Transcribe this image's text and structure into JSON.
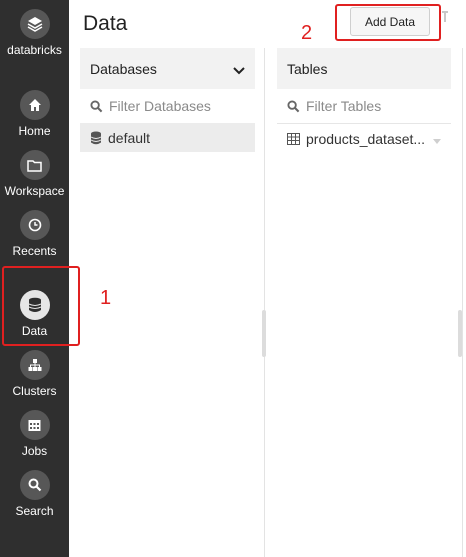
{
  "sidebar": {
    "brand_label": "databricks",
    "items": [
      {
        "label": "Home",
        "icon": "home-icon"
      },
      {
        "label": "Workspace",
        "icon": "folder-icon"
      },
      {
        "label": "Recents",
        "icon": "clock-icon"
      },
      {
        "label": "Data",
        "icon": "database-icon",
        "active": true
      },
      {
        "label": "Clusters",
        "icon": "clusters-icon"
      },
      {
        "label": "Jobs",
        "icon": "calendar-icon"
      },
      {
        "label": "Search",
        "icon": "search-icon"
      }
    ]
  },
  "header": {
    "title": "Data",
    "add_data_label": "Add Data"
  },
  "databases_panel": {
    "title": "Databases",
    "filter_placeholder": "Filter Databases",
    "items": [
      "default"
    ]
  },
  "tables_panel": {
    "title": "Tables",
    "filter_placeholder": "Filter Tables",
    "items": [
      "products_dataset..."
    ]
  },
  "annotations": {
    "first": "1",
    "second": "2"
  },
  "colors": {
    "sidebar_bg": "#2f2f2f",
    "annotation_red": "#e02020"
  }
}
